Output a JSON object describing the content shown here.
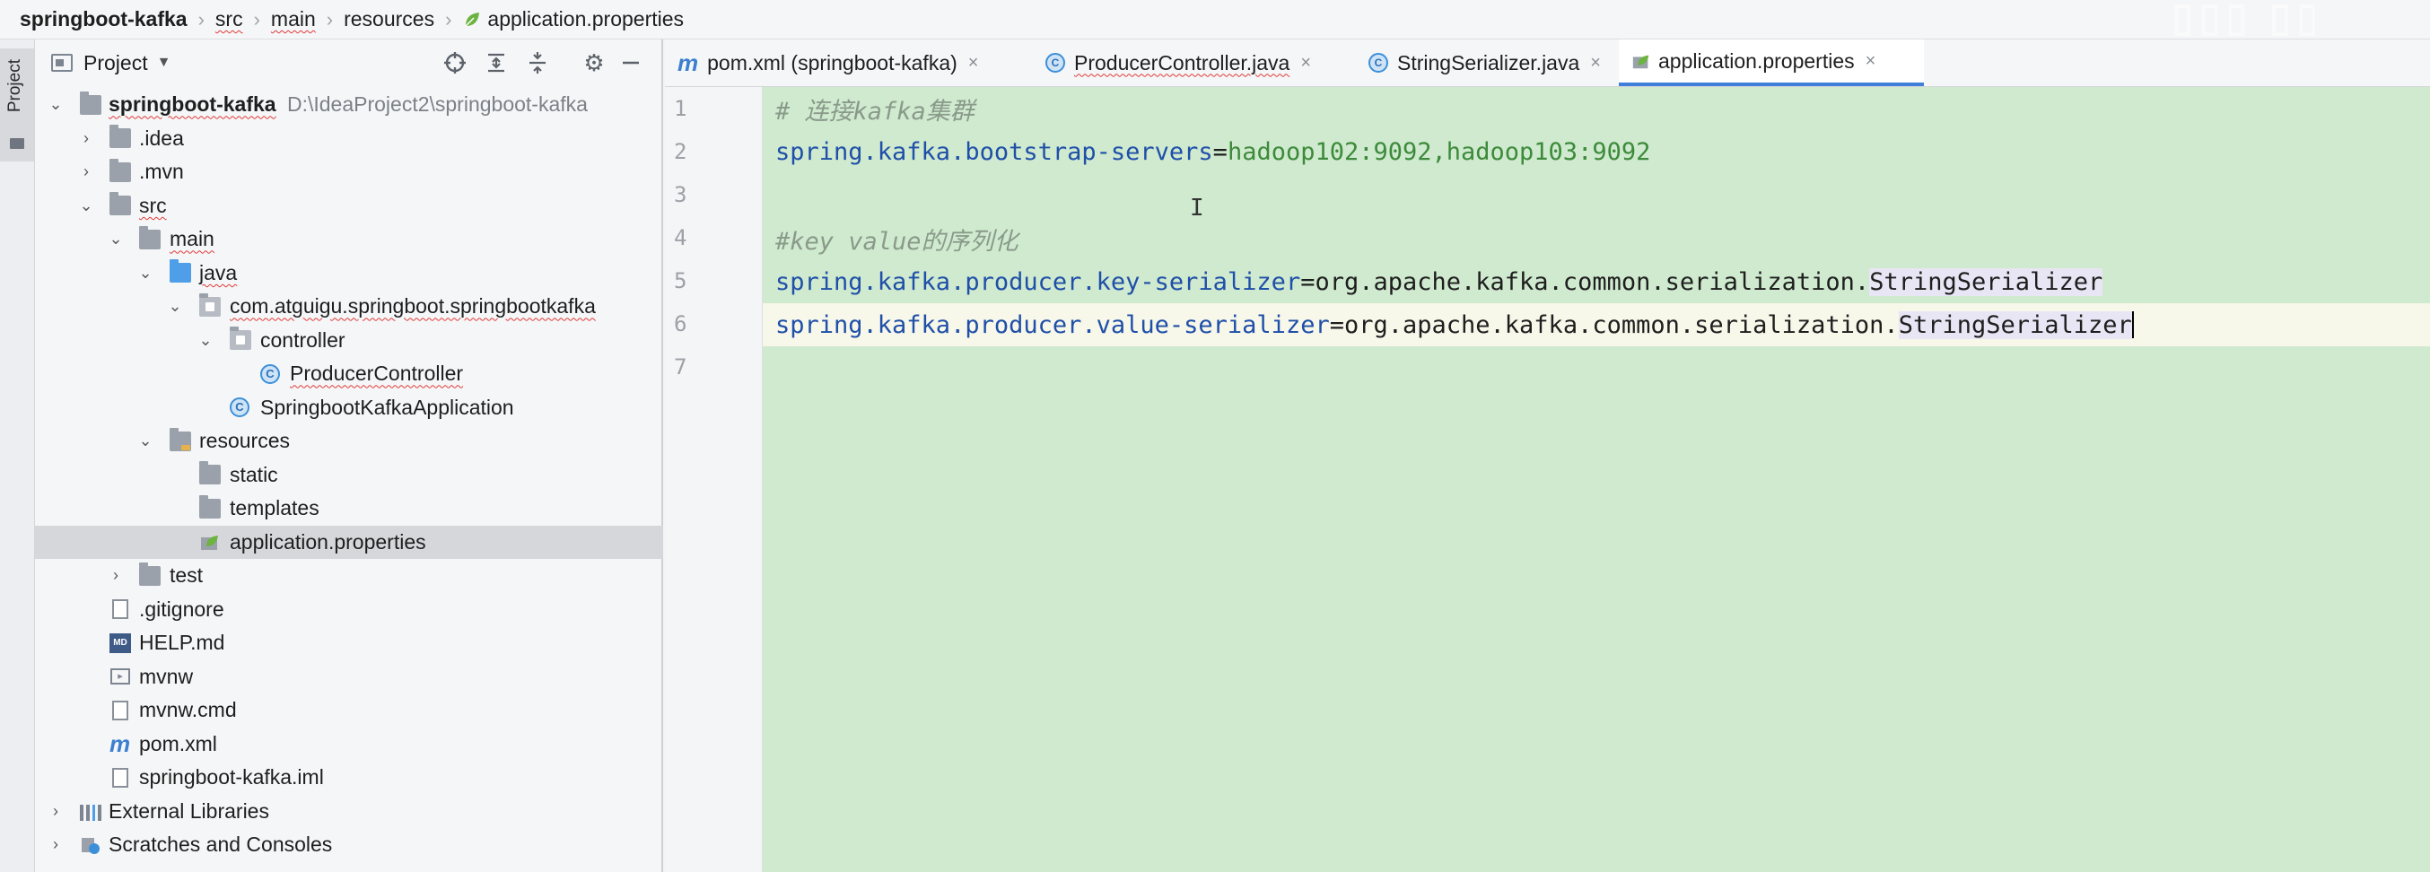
{
  "breadcrumb": [
    "springboot-kafka",
    "src",
    "main",
    "resources",
    "application.properties"
  ],
  "stripe_label": "Project",
  "panel": {
    "title": "Project"
  },
  "tree": [
    {
      "label": "springboot-kafka",
      "extra": "D:\\IdeaProject2\\springboot-kafka",
      "icon": "module-folder-icon",
      "arrow": "expanded"
    },
    {
      "label": ".idea",
      "icon": "folder-icon",
      "arrow": "collapsed"
    },
    {
      "label": ".mvn",
      "icon": "folder-icon",
      "arrow": "collapsed"
    },
    {
      "label": "src",
      "icon": "folder-icon",
      "arrow": "expanded"
    },
    {
      "label": "main",
      "icon": "folder-icon",
      "arrow": "expanded"
    },
    {
      "label": "java",
      "icon": "source-folder-icon",
      "arrow": "expanded"
    },
    {
      "label": "com.atguigu.springboot.springbootkafka",
      "icon": "package-icon",
      "arrow": "expanded"
    },
    {
      "label": "controller",
      "icon": "package-icon",
      "arrow": "expanded"
    },
    {
      "label": "ProducerController",
      "icon": "class-icon",
      "arrow": "none"
    },
    {
      "label": "SpringbootKafkaApplication",
      "icon": "spring-class-icon",
      "arrow": "none"
    },
    {
      "label": "resources",
      "icon": "resources-folder-icon",
      "arrow": "expanded"
    },
    {
      "label": "static",
      "icon": "folder-icon",
      "arrow": "none"
    },
    {
      "label": "templates",
      "icon": "folder-icon",
      "arrow": "none"
    },
    {
      "label": "application.properties",
      "icon": "spring-properties-icon",
      "arrow": "none",
      "selected": true
    },
    {
      "label": "test",
      "icon": "folder-icon",
      "arrow": "collapsed"
    },
    {
      "label": ".gitignore",
      "icon": "gitignore-file-icon",
      "arrow": "none"
    },
    {
      "label": "HELP.md",
      "icon": "markdown-file-icon",
      "arrow": "none"
    },
    {
      "label": "mvnw",
      "icon": "script-file-icon",
      "arrow": "none"
    },
    {
      "label": "mvnw.cmd",
      "icon": "cmd-file-icon",
      "arrow": "none"
    },
    {
      "label": "pom.xml",
      "icon": "maven-icon",
      "arrow": "none"
    },
    {
      "label": "springboot-kafka.iml",
      "icon": "iml-file-icon",
      "arrow": "none"
    },
    {
      "label": "External Libraries",
      "icon": "libraries-icon",
      "arrow": "collapsed"
    },
    {
      "label": "Scratches and Consoles",
      "icon": "scratches-icon",
      "arrow": "collapsed"
    }
  ],
  "tabs": [
    {
      "label": "pom.xml (springboot-kafka)",
      "icon": "maven-icon"
    },
    {
      "label": "ProducerController.java",
      "icon": "class-icon"
    },
    {
      "label": "StringSerializer.java",
      "icon": "class-icon"
    },
    {
      "label": "application.properties",
      "icon": "spring-properties-icon",
      "active": true
    }
  ],
  "code": {
    "line_numbers": [
      "1",
      "2",
      "3",
      "4",
      "5",
      "6",
      "7"
    ],
    "line1": "# 连接kafka集群",
    "line2_key": "spring.kafka.bootstrap-servers",
    "line2_eq": "=",
    "line2_val": "hadoop102:9092,hadoop103:9092",
    "line4": "#key value的序列化",
    "line5_key": "spring.kafka.producer.key-serializer",
    "line5_eq": "=",
    "line5_val": "org.apache.kafka.common.serialization.",
    "line5_cls": "StringSerializer",
    "line6_key": "spring.kafka.producer.value-serializer",
    "line6_eq": "=",
    "line6_val": "org.apache.kafka.common.serialization.",
    "line6_cls": "StringSerializer"
  },
  "colors": {
    "editor_bg": "#cfeacf",
    "comment": "#8a9a8a",
    "key": "#1f4fa8",
    "value": "#3d8a3a",
    "active_tab_underline": "#3f7fd9"
  }
}
